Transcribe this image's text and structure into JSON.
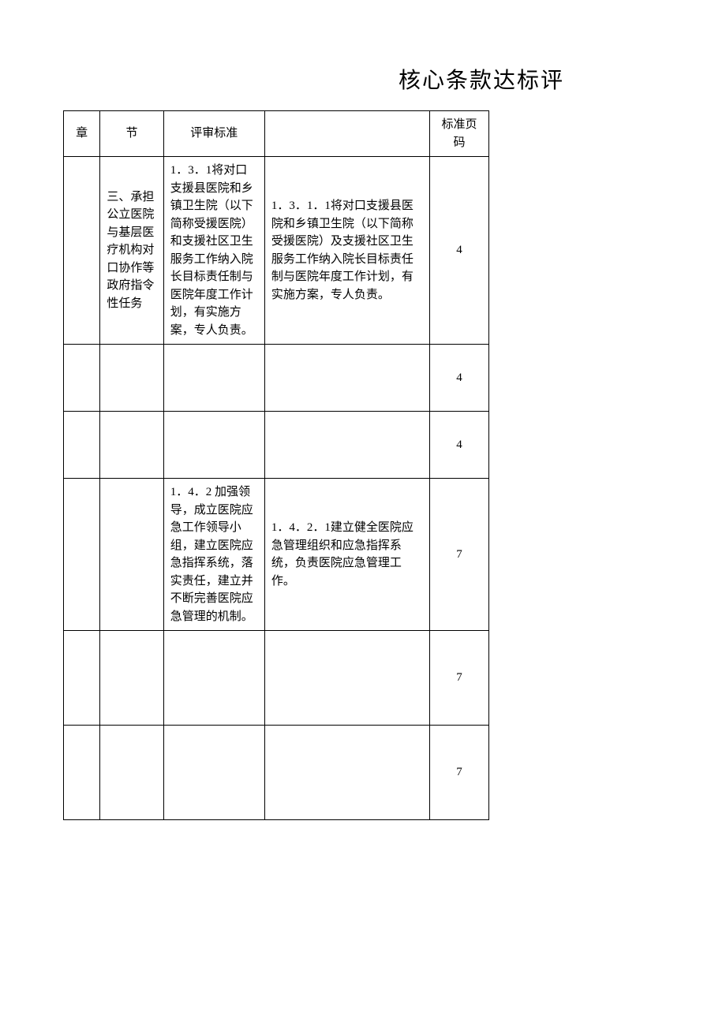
{
  "title": "核心条款达标评",
  "headers": {
    "chapter": "章",
    "section": "节",
    "standard": "评审标准",
    "detail": "",
    "page": "标准页码"
  },
  "rows": [
    {
      "chapter": "",
      "section": "三、承担公立医院与基层医疗机构对口协作等政府指令性任务",
      "standard": "1．3．1将对口支援县医院和乡镇卫生院（以下简称受援医院）和支援社区卫生服务工作纳入院长目标责任制与医院年度工作计划，有实施方案，专人负责。",
      "detail": "1．3．1．1将对口支援县医院和乡镇卫生院（以下简称受援医院）及支援社区卫生服务工作纳入院长目标责任制与医院年度工作计划，有实施方案，专人负责。",
      "page": "4"
    },
    {
      "chapter": "",
      "section": "",
      "standard": "",
      "detail": "",
      "page": "4"
    },
    {
      "chapter": "",
      "section": "",
      "standard": "",
      "detail": "",
      "page": "4"
    },
    {
      "chapter": "",
      "section": "",
      "standard": "1．4．2 加强领导，成立医院应急工作领导小组，建立医院应急指挥系统，落实责任，建立并不断完善医院应急管理的机制。",
      "detail": "1．4．2．1建立健全医院应急管理组织和应急指挥系统，负责医院应急管理工作。",
      "page": "7"
    },
    {
      "chapter": "",
      "section": "",
      "standard": "",
      "detail": "",
      "page": "7"
    },
    {
      "chapter": "",
      "section": "",
      "standard": "",
      "detail": "",
      "page": "7"
    }
  ]
}
